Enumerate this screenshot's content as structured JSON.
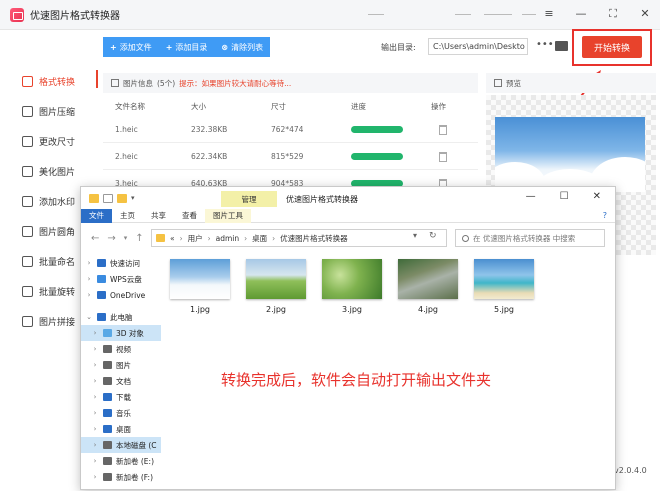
{
  "app": {
    "title": "优速图片格式转换器"
  },
  "window_buttons": {
    "menu": "≡",
    "minimize": "—",
    "maximize": "⛶",
    "close": "✕"
  },
  "sidebar": {
    "items": [
      {
        "label": "格式转换",
        "icon": "convert-icon",
        "active": true
      },
      {
        "label": "图片压缩",
        "icon": "compress-icon"
      },
      {
        "label": "更改尺寸",
        "icon": "resize-icon"
      },
      {
        "label": "美化图片",
        "icon": "beautify-icon"
      },
      {
        "label": "添加水印",
        "icon": "watermark-icon"
      },
      {
        "label": "图片圆角",
        "icon": "rounded-corner-icon"
      },
      {
        "label": "批量命名",
        "icon": "rename-icon"
      },
      {
        "label": "批量旋转",
        "icon": "rotate-icon"
      },
      {
        "label": "图片拼接",
        "icon": "stitch-icon"
      }
    ]
  },
  "toolbar": {
    "add_file": "添加文件",
    "add_folder": "添加目录",
    "clear_list": "清除列表",
    "output_label": "输出目录:",
    "output_path": "C:\\Users\\admin\\Deskto",
    "more": "•••",
    "start_label": "开始转换"
  },
  "file_info": {
    "title": "图片信息",
    "count": "(5个)",
    "warning": "提示：如果图片较大请耐心等待...",
    "columns": [
      "文件名称",
      "大小",
      "尺寸",
      "进度",
      "操作"
    ],
    "rows": [
      {
        "name": "1.heic",
        "size": "232.38KB",
        "dims": "762*474",
        "progress": 1.0
      },
      {
        "name": "2.heic",
        "size": "622.34KB",
        "dims": "815*529",
        "progress": 1.0
      },
      {
        "name": "3.heic",
        "size": "640.63KB",
        "dims": "904*583",
        "progress": 1.0
      }
    ]
  },
  "preview": {
    "title": "预览"
  },
  "version": "v2.0.4.0",
  "explorer": {
    "manage_tab": "管理",
    "title": "优速图片格式转换器",
    "ribbon": [
      "文件",
      "主页",
      "共享",
      "查看",
      "图片工具"
    ],
    "path": [
      "«",
      "用户",
      "admin",
      "桌面",
      "优速图片格式转换器"
    ],
    "search_placeholder": "在 优速图片格式转换器 中搜索",
    "nav": [
      {
        "label": "快速访问",
        "icon": "star-icon",
        "color": "#2b6ec7"
      },
      {
        "label": "WPS云盘",
        "icon": "cloud-icon",
        "color": "#3a8be0"
      },
      {
        "label": "OneDrive",
        "icon": "onedrive-icon",
        "color": "#2b6ec7"
      },
      {
        "label": "此电脑",
        "icon": "computer-icon",
        "color": "#2b6ec7",
        "expanded": true
      },
      {
        "label": "3D 对象",
        "icon": "3d-objects-icon",
        "color": "#5aa9e6",
        "selected": true
      },
      {
        "label": "视频",
        "icon": "video-icon",
        "color": "#666"
      },
      {
        "label": "图片",
        "icon": "pictures-icon",
        "color": "#666"
      },
      {
        "label": "文档",
        "icon": "documents-icon",
        "color": "#666"
      },
      {
        "label": "下载",
        "icon": "download-icon",
        "color": "#2b6ec7"
      },
      {
        "label": "音乐",
        "icon": "music-icon",
        "color": "#2b6ec7"
      },
      {
        "label": "桌面",
        "icon": "desktop-icon",
        "color": "#2b6ec7"
      },
      {
        "label": "本地磁盘 (C",
        "icon": "disk-icon",
        "color": "#666",
        "selected": true
      },
      {
        "label": "新加卷 (E:)",
        "icon": "drive-icon",
        "color": "#666"
      },
      {
        "label": "新加卷 (F:)",
        "icon": "drive-icon",
        "color": "#666"
      }
    ],
    "files": [
      {
        "name": "1.jpg",
        "thumb": "clouds"
      },
      {
        "name": "2.jpg",
        "thumb": "meadow"
      },
      {
        "name": "3.jpg",
        "thumb": "field"
      },
      {
        "name": "4.jpg",
        "thumb": "river"
      },
      {
        "name": "5.jpg",
        "thumb": "beach"
      }
    ],
    "caption": "转换完成后，软件会自动打开输出文件夹"
  },
  "colors": {
    "accent": "#e8432c",
    "tool_blue": "#3f9bf5",
    "progress": "#21b56c",
    "highlight": "#e8322c"
  }
}
